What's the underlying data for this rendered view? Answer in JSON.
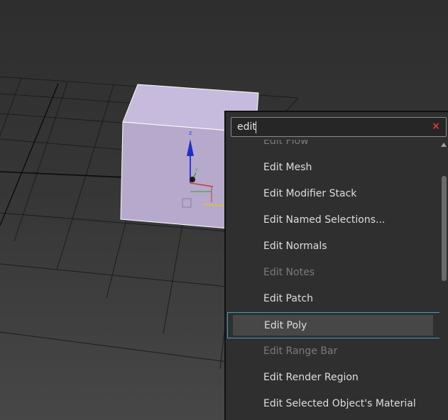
{
  "search": {
    "value": "edit",
    "clear_glyph": "×"
  },
  "gizmo": {
    "z_label": "z",
    "y_label": "y"
  },
  "results": [
    {
      "label": "Edit Flow",
      "enabled": false,
      "selected": false
    },
    {
      "label": "Edit Mesh",
      "enabled": true,
      "selected": false
    },
    {
      "label": "Edit Modifier Stack",
      "enabled": true,
      "selected": false
    },
    {
      "label": "Edit Named Selections...",
      "enabled": true,
      "selected": false
    },
    {
      "label": "Edit Normals",
      "enabled": true,
      "selected": false
    },
    {
      "label": "Edit Notes",
      "enabled": false,
      "selected": false
    },
    {
      "label": "Edit Patch",
      "enabled": true,
      "selected": false
    },
    {
      "label": "Edit Poly",
      "enabled": true,
      "selected": true
    },
    {
      "label": "Edit Range Bar",
      "enabled": false,
      "selected": false
    },
    {
      "label": "Edit Render Region",
      "enabled": true,
      "selected": false
    },
    {
      "label": "Edit Selected Object's Material",
      "enabled": true,
      "selected": false
    }
  ],
  "colors": {
    "accent": "#3aa0c8",
    "clear": "#e53a3a",
    "box_face": "#b6a9cc",
    "box_top": "#c6bbdc"
  }
}
